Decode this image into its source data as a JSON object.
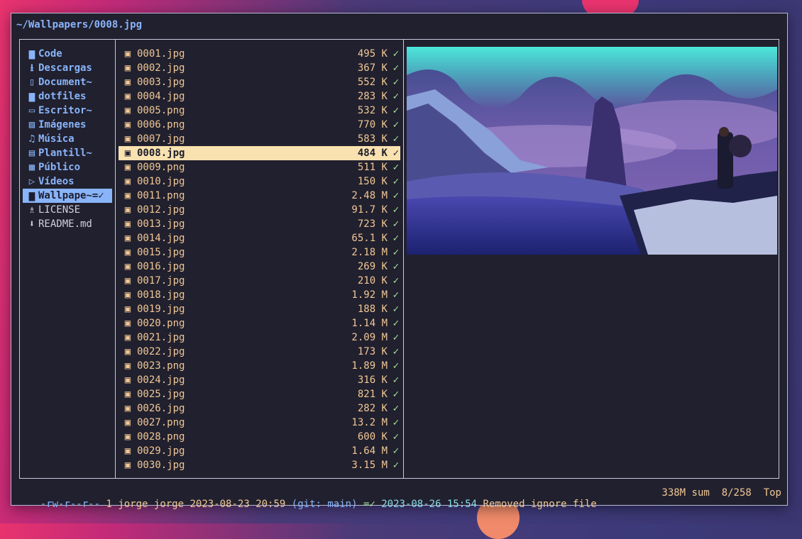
{
  "window": {
    "path": "~/Wallpapers/0008.jpg"
  },
  "parent_dir": [
    {
      "icon": "folder-icon",
      "glyph": "▆",
      "label": "Code",
      "type": "dir"
    },
    {
      "icon": "download-folder-icon",
      "glyph": "⭳",
      "label": "Descargas",
      "type": "dir"
    },
    {
      "icon": "document-folder-icon",
      "glyph": "▯",
      "label": "Document~",
      "type": "dir"
    },
    {
      "icon": "folder-icon",
      "glyph": "▆",
      "label": "dotfiles",
      "type": "dir"
    },
    {
      "icon": "desktop-folder-icon",
      "glyph": "▭",
      "label": "Escritor~",
      "type": "dir"
    },
    {
      "icon": "pictures-folder-icon",
      "glyph": "▨",
      "label": "Imágenes",
      "type": "dir"
    },
    {
      "icon": "music-folder-icon",
      "glyph": "♫",
      "label": "Música",
      "type": "dir"
    },
    {
      "icon": "templates-folder-icon",
      "glyph": "▤",
      "label": "Plantill~",
      "type": "dir"
    },
    {
      "icon": "public-folder-icon",
      "glyph": "▦",
      "label": "Público",
      "type": "dir"
    },
    {
      "icon": "videos-folder-icon",
      "glyph": "▷",
      "label": "Vídeos",
      "type": "dir"
    },
    {
      "icon": "folder-icon",
      "glyph": "▆",
      "label": "Wallpape~=✓",
      "type": "dir",
      "selected": true
    },
    {
      "icon": "license-file-icon",
      "glyph": "♗",
      "label": "LICENSE",
      "type": "file"
    },
    {
      "icon": "markdown-file-icon",
      "glyph": "⬇",
      "label": "README.md",
      "type": "file"
    }
  ],
  "files": [
    {
      "name": "0001.jpg",
      "size": "495 K"
    },
    {
      "name": "0002.jpg",
      "size": "367 K"
    },
    {
      "name": "0003.jpg",
      "size": "552 K"
    },
    {
      "name": "0004.jpg",
      "size": "283 K"
    },
    {
      "name": "0005.png",
      "size": "532 K"
    },
    {
      "name": "0006.png",
      "size": "770 K"
    },
    {
      "name": "0007.jpg",
      "size": "583 K"
    },
    {
      "name": "0008.jpg",
      "size": "484 K",
      "selected": true
    },
    {
      "name": "0009.png",
      "size": "511 K"
    },
    {
      "name": "0010.jpg",
      "size": "150 K"
    },
    {
      "name": "0011.png",
      "size": "2.48 M"
    },
    {
      "name": "0012.jpg",
      "size": "91.7 K"
    },
    {
      "name": "0013.jpg",
      "size": "723 K"
    },
    {
      "name": "0014.jpg",
      "size": "65.1 K"
    },
    {
      "name": "0015.jpg",
      "size": "2.18 M"
    },
    {
      "name": "0016.jpg",
      "size": "269 K"
    },
    {
      "name": "0017.jpg",
      "size": "210 K"
    },
    {
      "name": "0018.jpg",
      "size": "1.92 M"
    },
    {
      "name": "0019.jpg",
      "size": "188 K"
    },
    {
      "name": "0020.png",
      "size": "1.14 M"
    },
    {
      "name": "0021.jpg",
      "size": "2.09 M"
    },
    {
      "name": "0022.jpg",
      "size": "173 K"
    },
    {
      "name": "0023.png",
      "size": "1.89 M"
    },
    {
      "name": "0024.jpg",
      "size": "316 K"
    },
    {
      "name": "0025.jpg",
      "size": "821 K"
    },
    {
      "name": "0026.jpg",
      "size": "282 K"
    },
    {
      "name": "0027.png",
      "size": "13.2 M"
    },
    {
      "name": "0028.png",
      "size": "600 K"
    },
    {
      "name": "0029.jpg",
      "size": "1.64 M"
    },
    {
      "name": "0030.jpg",
      "size": "3.15 M"
    }
  ],
  "file_check": "✓",
  "file_icon": "▣",
  "status": {
    "perms": "-rw-r--r--",
    "links": "1",
    "owner": "jorge jorge",
    "mtime": "2023-08-23 20:59",
    "git": "(git: main)",
    "git_state": "=✓",
    "commit_date": "2023-08-26 15:54",
    "commit_msg": "Removed ignore file",
    "disk": "338M sum",
    "position": "8/258",
    "scroll": "Top"
  },
  "colors": {
    "dir": "#89b4fa",
    "file": "#f0c896",
    "check": "#a6e3a1",
    "selected_file_bg": "#f9e2af",
    "selected_dir_bg": "#89b4fa",
    "terminal_bg": "#21202e"
  }
}
